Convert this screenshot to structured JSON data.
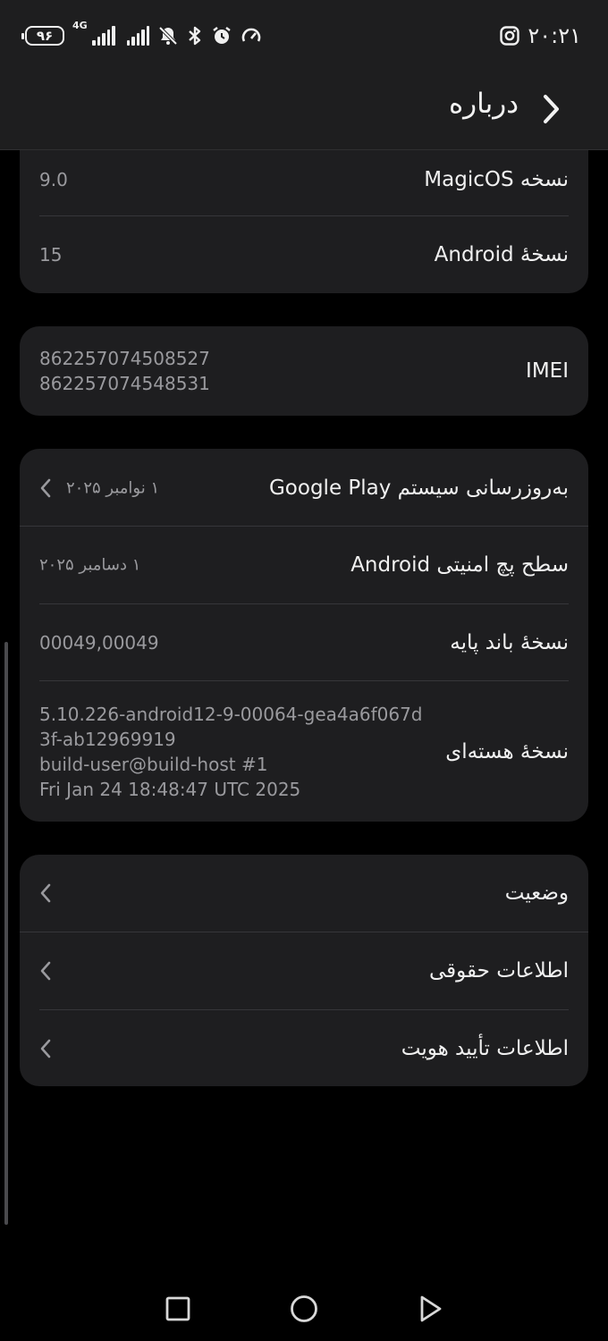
{
  "status_bar": {
    "battery": "۹۶",
    "network": "4G",
    "time": "۲۰:۲۱"
  },
  "app_bar": {
    "title": "درباره"
  },
  "card_os": {
    "rows": [
      {
        "label": "نسخه MagicOS",
        "value": "9.0"
      },
      {
        "label": "نسخهٔ Android",
        "value": "15"
      }
    ]
  },
  "card_imei": {
    "label": "IMEI",
    "values": [
      "862257074508527",
      "862257074548531"
    ]
  },
  "card_system": {
    "google_play": {
      "label": "به‌روزرسانی سیستم Google Play",
      "value": "۱ نوامبر ۲۰۲۵"
    },
    "security_patch": {
      "label": "سطح پچ امنیتی Android",
      "value": "۱ دسامبر ۲۰۲۵"
    },
    "baseband": {
      "label": "نسخهٔ باند پایه",
      "value": "00049,00049"
    },
    "kernel": {
      "label": "نسخهٔ هسته‌ای",
      "lines": [
        "5.10.226-android12-9-00064-gea4a6f067d",
        "3f-ab12969919",
        "build-user@build-host #1",
        "Fri Jan 24 18:48:47 UTC 2025"
      ]
    }
  },
  "card_links": {
    "items": [
      {
        "label": "وضعیت"
      },
      {
        "label": "اطلاعات حقوقی"
      },
      {
        "label": "اطلاعات تأیید هویت"
      }
    ]
  },
  "icons": {
    "battery": "battery-icon",
    "signal": "signal-icon",
    "mute": "notifications-off-icon",
    "bluetooth": "bluetooth-icon",
    "alarm": "alarm-icon",
    "speed": "speedometer-icon",
    "instagram": "instagram-icon",
    "back": "chevron-right-icon",
    "chevron": "chevron-left-icon",
    "nav_recent": "recents-square-icon",
    "nav_home": "home-circle-icon",
    "nav_back": "back-triangle-icon"
  },
  "colors": {
    "background": "#000000",
    "card": "#1e1e20",
    "bar": "#1e1e1f",
    "text_primary": "#f0f0f0",
    "text_secondary": "#9a9a9e"
  }
}
